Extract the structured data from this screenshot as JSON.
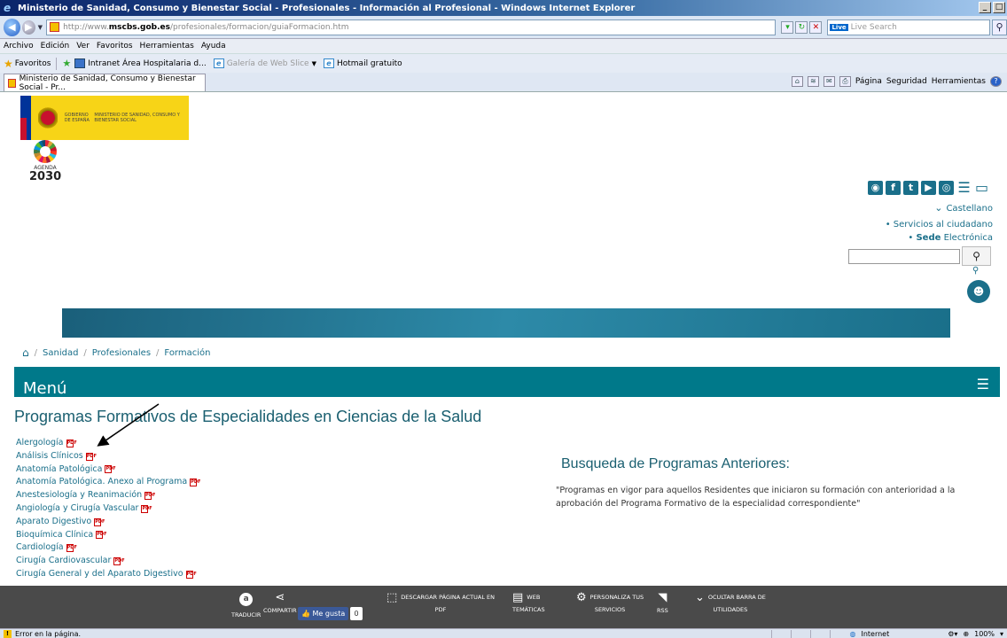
{
  "window": {
    "title": "Ministerio de Sanidad, Consumo y Bienestar Social - Profesionales - Información al Profesional  - Windows Internet Explorer",
    "min": "_",
    "max": "□"
  },
  "address": {
    "prefix": "http://www.",
    "domain": "mscbs.gob.es",
    "path": "/profesionales/formacion/guiaFormacion.htm",
    "search_placeholder": "Live Search",
    "search_brand": "Live"
  },
  "menubar": [
    "Archivo",
    "Edición",
    "Ver",
    "Favoritos",
    "Herramientas",
    "Ayuda"
  ],
  "favorites": {
    "label": "Favoritos",
    "items": [
      "Intranet Área Hospitalaria d...",
      "Galería de Web Slice",
      "Hotmail gratuito"
    ]
  },
  "tab": {
    "label": "Ministerio de Sanidad, Consumo y Bienestar Social - Pr..."
  },
  "tabtools": {
    "page": "Página",
    "security": "Seguridad",
    "tools": "Herramientas"
  },
  "header": {
    "gov_text": "GOBIERNO DE ESPAÑA",
    "ministry_text": "MINISTERIO DE SANIDAD, CONSUMO Y BIENESTAR SOCIAL",
    "agenda_label": "AGENDA",
    "agenda_year": "2030",
    "language": "Castellano",
    "link_services": "Servicios al ciudadano",
    "link_sede_bold": "Sede",
    "link_sede_rest": "Electrónica"
  },
  "breadcrumb": [
    "Sanidad",
    "Profesionales",
    "Formación"
  ],
  "nav": {
    "menu_label": "Menú"
  },
  "main": {
    "title": "Programas Formativos de Especialidades en Ciencias de la Salud",
    "pdf_icon": "PDF",
    "specialties": [
      "Alergología",
      "Análisis Clínicos",
      "Anatomía Patológica",
      "Anatomía Patológica. Anexo al Programa",
      "Anestesiología y Reanimación",
      "Angiología y Cirugía Vascular",
      "Aparato Digestivo",
      "Bioquímica Clínica",
      "Cardiología",
      "Cirugía Cardiovascular",
      "Cirugía General y del Aparato Digestivo"
    ],
    "prev_title": "Busqueda de Programas Anteriores:",
    "prev_desc": "\"Programas en vigor para aquellos Residentes que iniciaron su formación con anterioridad a la aprobación del Programa Formativo de la especialidad correspondiente\""
  },
  "utilbar": {
    "translate": "TRADUCIR",
    "share": "COMPARTIR",
    "like": "Me gusta",
    "like_count": "0",
    "download_line1": "DESCARGAR PÁGINA ACTUAL EN",
    "download_line2": "PDF",
    "web_line1": "WEB",
    "web_line2": "TEMÁTICAS",
    "personalize_line1": "PERSONALIZA TUS",
    "personalize_line2": "SERVICIOS",
    "rss": "RSS",
    "hide_line1": "OCULTAR BARRA DE",
    "hide_line2": "UTILIDADES"
  },
  "status": {
    "message": "Error en la página.",
    "zone": "Internet",
    "zoom": "100%"
  }
}
